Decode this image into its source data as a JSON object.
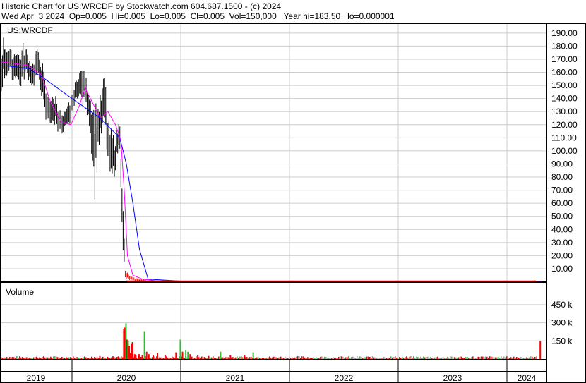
{
  "header": {
    "line1": "Historic Chart for US:WRCDF by Stockwatch.com 604.687.1500 - (c) 2024",
    "line2": "Wed Apr  3 2024  Op=0.005  Hi=0.005  Lo=0.005  Cl=0.005  Vol=150,000   Year hi=183.50   lo=0.000001"
  },
  "chart_data": {
    "type": "line",
    "title": "US:WRCDF",
    "volume_title": "Volume",
    "colors": {
      "price": "#000000",
      "ma_short": "#ff00ff",
      "ma_long": "#0000ff",
      "vol_down": "#ff0000",
      "vol_up": "#33bb33",
      "vol_flat": "#999999",
      "grid": "#cccccc"
    },
    "x_range": [
      2019.33,
      2024.32
    ],
    "years": [
      "2019",
      "2020",
      "2021",
      "2022",
      "2023",
      "2024"
    ],
    "year_starts": [
      2019,
      2020,
      2021,
      2022,
      2023,
      2024
    ],
    "price_ylim": [
      0,
      195
    ],
    "price_ticks": [
      "10.00",
      "20.00",
      "30.00",
      "40.00",
      "50.00",
      "60.00",
      "70.00",
      "80.00",
      "90.00",
      "100.00",
      "110.00",
      "120.00",
      "130.00",
      "140.00",
      "150.00",
      "160.00",
      "170.00",
      "180.00",
      "190.00"
    ],
    "price_tick_values": [
      10,
      20,
      30,
      40,
      50,
      60,
      70,
      80,
      90,
      100,
      110,
      120,
      130,
      140,
      150,
      160,
      170,
      180,
      190
    ],
    "volume_ylim": [
      0,
      560
    ],
    "volume_ticks": [
      "150 k",
      "300 k",
      "450 k"
    ],
    "volume_tick_values": [
      150,
      300,
      450
    ],
    "price_hl": [
      [
        2019.34,
        145,
        170
      ],
      [
        2019.37,
        158,
        182
      ],
      [
        2019.4,
        160,
        178
      ],
      [
        2019.43,
        162,
        175
      ],
      [
        2019.46,
        155,
        172
      ],
      [
        2019.49,
        160,
        176
      ],
      [
        2019.52,
        150,
        170
      ],
      [
        2019.55,
        158,
        178
      ],
      [
        2019.58,
        160,
        175
      ],
      [
        2019.61,
        156,
        168
      ],
      [
        2019.64,
        150,
        165
      ],
      [
        2019.67,
        158,
        176
      ],
      [
        2019.7,
        155,
        170
      ],
      [
        2019.73,
        140,
        162
      ],
      [
        2019.76,
        125,
        145
      ],
      [
        2019.79,
        125,
        140
      ],
      [
        2019.82,
        120,
        138
      ],
      [
        2019.85,
        125,
        140
      ],
      [
        2019.88,
        115,
        130
      ],
      [
        2019.91,
        112,
        125
      ],
      [
        2019.94,
        118,
        128
      ],
      [
        2019.97,
        120,
        135
      ],
      [
        2020.0,
        128,
        140
      ],
      [
        2020.03,
        138,
        150
      ],
      [
        2020.06,
        145,
        158
      ],
      [
        2020.09,
        140,
        160
      ],
      [
        2020.12,
        135,
        155
      ],
      [
        2020.15,
        130,
        145
      ],
      [
        2020.18,
        105,
        135
      ],
      [
        2020.21,
        75,
        125
      ],
      [
        2020.24,
        105,
        130
      ],
      [
        2020.27,
        115,
        140
      ],
      [
        2020.3,
        125,
        155
      ],
      [
        2020.33,
        95,
        120
      ],
      [
        2020.36,
        80,
        110
      ],
      [
        2020.39,
        85,
        105
      ],
      [
        2020.42,
        100,
        115
      ],
      [
        2020.44,
        105,
        122
      ],
      [
        2020.47,
        20,
        50
      ],
      [
        2020.49,
        3,
        8
      ],
      [
        2020.52,
        2,
        5
      ],
      [
        2020.56,
        1,
        3
      ],
      [
        2020.62,
        0.5,
        2
      ],
      [
        2020.7,
        0.2,
        1
      ],
      [
        2020.85,
        0.1,
        0.8
      ],
      [
        2021.2,
        0.05,
        0.5
      ],
      [
        2021.6,
        0.02,
        0.3
      ],
      [
        2022.5,
        0.01,
        0.2
      ],
      [
        2023.5,
        0.005,
        0.1
      ],
      [
        2024.3,
        0.005,
        0.01
      ]
    ],
    "ma_short": [
      [
        2019.33,
        168
      ],
      [
        2019.45,
        167
      ],
      [
        2019.6,
        165
      ],
      [
        2019.72,
        158
      ],
      [
        2019.8,
        138
      ],
      [
        2019.9,
        122
      ],
      [
        2019.99,
        120
      ],
      [
        2020.07,
        135
      ],
      [
        2020.12,
        148
      ],
      [
        2020.2,
        135
      ],
      [
        2020.26,
        125
      ],
      [
        2020.33,
        130
      ],
      [
        2020.4,
        120
      ],
      [
        2020.45,
        108
      ],
      [
        2020.48,
        70
      ],
      [
        2020.51,
        20
      ],
      [
        2020.56,
        5
      ],
      [
        2020.65,
        2
      ],
      [
        2020.8,
        0.5
      ],
      [
        2024.32,
        0.2
      ]
    ],
    "ma_long": [
      [
        2019.39,
        165
      ],
      [
        2019.6,
        163
      ],
      [
        2019.75,
        155
      ],
      [
        2020.0,
        140
      ],
      [
        2020.26,
        125
      ],
      [
        2020.44,
        110
      ],
      [
        2020.5,
        90
      ],
      [
        2020.56,
        60
      ],
      [
        2020.62,
        25
      ],
      [
        2020.7,
        2
      ],
      [
        2020.9,
        1
      ],
      [
        2021.0,
        0.5
      ]
    ],
    "volume_k": [
      [
        2019.55,
        8
      ],
      [
        2019.8,
        10
      ],
      [
        2019.95,
        12
      ],
      [
        2020.25,
        25
      ],
      [
        2020.32,
        18
      ],
      [
        2020.37,
        22
      ],
      [
        2020.42,
        20
      ],
      [
        2020.47,
        250,
        "d"
      ],
      [
        2020.48,
        260,
        "d"
      ],
      [
        2020.49,
        295,
        "u"
      ],
      [
        2020.5,
        160,
        "d"
      ],
      [
        2020.51,
        150,
        "u"
      ],
      [
        2020.52,
        110,
        "d"
      ],
      [
        2020.53,
        50,
        "d"
      ],
      [
        2020.54,
        130,
        "d"
      ],
      [
        2020.55,
        140,
        "d"
      ],
      [
        2020.57,
        40,
        "d"
      ],
      [
        2020.58,
        30,
        "d"
      ],
      [
        2020.61,
        40,
        "d"
      ],
      [
        2020.64,
        35,
        "d"
      ],
      [
        2020.66,
        230,
        "u"
      ],
      [
        2020.68,
        60,
        "d"
      ],
      [
        2020.7,
        40,
        "d"
      ],
      [
        2020.74,
        30,
        "d"
      ],
      [
        2020.78,
        50,
        "d"
      ],
      [
        2020.85,
        30,
        "d"
      ],
      [
        2020.95,
        55,
        "d"
      ],
      [
        2020.99,
        160,
        "u"
      ],
      [
        2021.01,
        60,
        "d"
      ],
      [
        2021.04,
        75,
        "u"
      ],
      [
        2021.06,
        60,
        "u"
      ],
      [
        2021.08,
        40,
        "d"
      ],
      [
        2021.15,
        30,
        "d"
      ],
      [
        2021.25,
        25,
        "d"
      ],
      [
        2021.36,
        60,
        "u"
      ],
      [
        2021.45,
        30,
        "d"
      ],
      [
        2021.58,
        30,
        "d"
      ],
      [
        2021.66,
        55,
        "u"
      ],
      [
        2021.9,
        15,
        "f"
      ],
      [
        2022.2,
        8,
        "d"
      ],
      [
        2022.6,
        6,
        "f"
      ],
      [
        2023.2,
        6,
        "f"
      ],
      [
        2023.6,
        6,
        "d"
      ],
      [
        2024.1,
        8,
        "d"
      ],
      [
        2024.3,
        150,
        "d"
      ]
    ]
  }
}
